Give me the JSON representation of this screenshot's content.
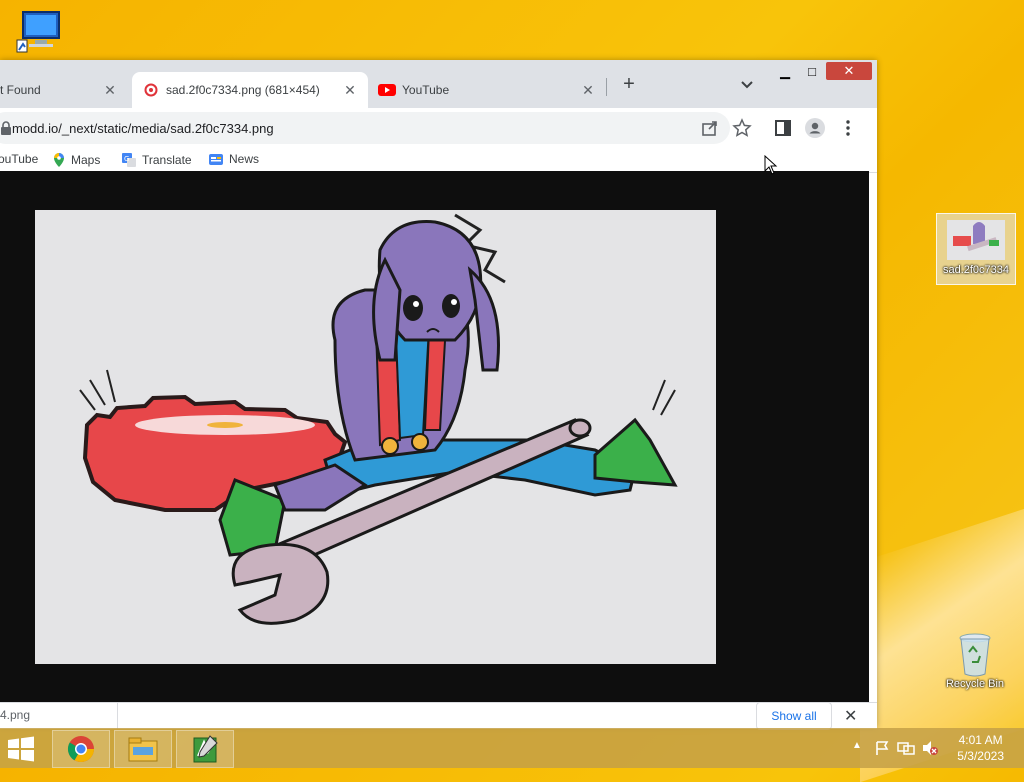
{
  "desktop": {
    "icons": [
      {
        "label": ""
      },
      {
        "label": "sad.2f0c7334"
      },
      {
        "label": "Recycle Bin"
      }
    ]
  },
  "browser": {
    "tabs": [
      {
        "title": "t Found"
      },
      {
        "title": "sad.2f0c7334.png (681×454)"
      },
      {
        "title": "YouTube"
      }
    ],
    "url": "modd.io/_next/static/media/sad.2f0c7334.png",
    "bookmarks": [
      {
        "label": "ouTube"
      },
      {
        "label": "Maps"
      },
      {
        "label": "Translate"
      },
      {
        "label": "News"
      }
    ],
    "download_item": "4.png",
    "show_all_label": "Show all"
  },
  "taskbar": {
    "time": "4:01 AM",
    "date": "5/3/2023"
  },
  "colors": {
    "desktop_bg": "#f6b300",
    "chrome_tabstrip": "#dee1e6",
    "close_button": "#c9473d",
    "link_blue": "#1a73e8"
  }
}
